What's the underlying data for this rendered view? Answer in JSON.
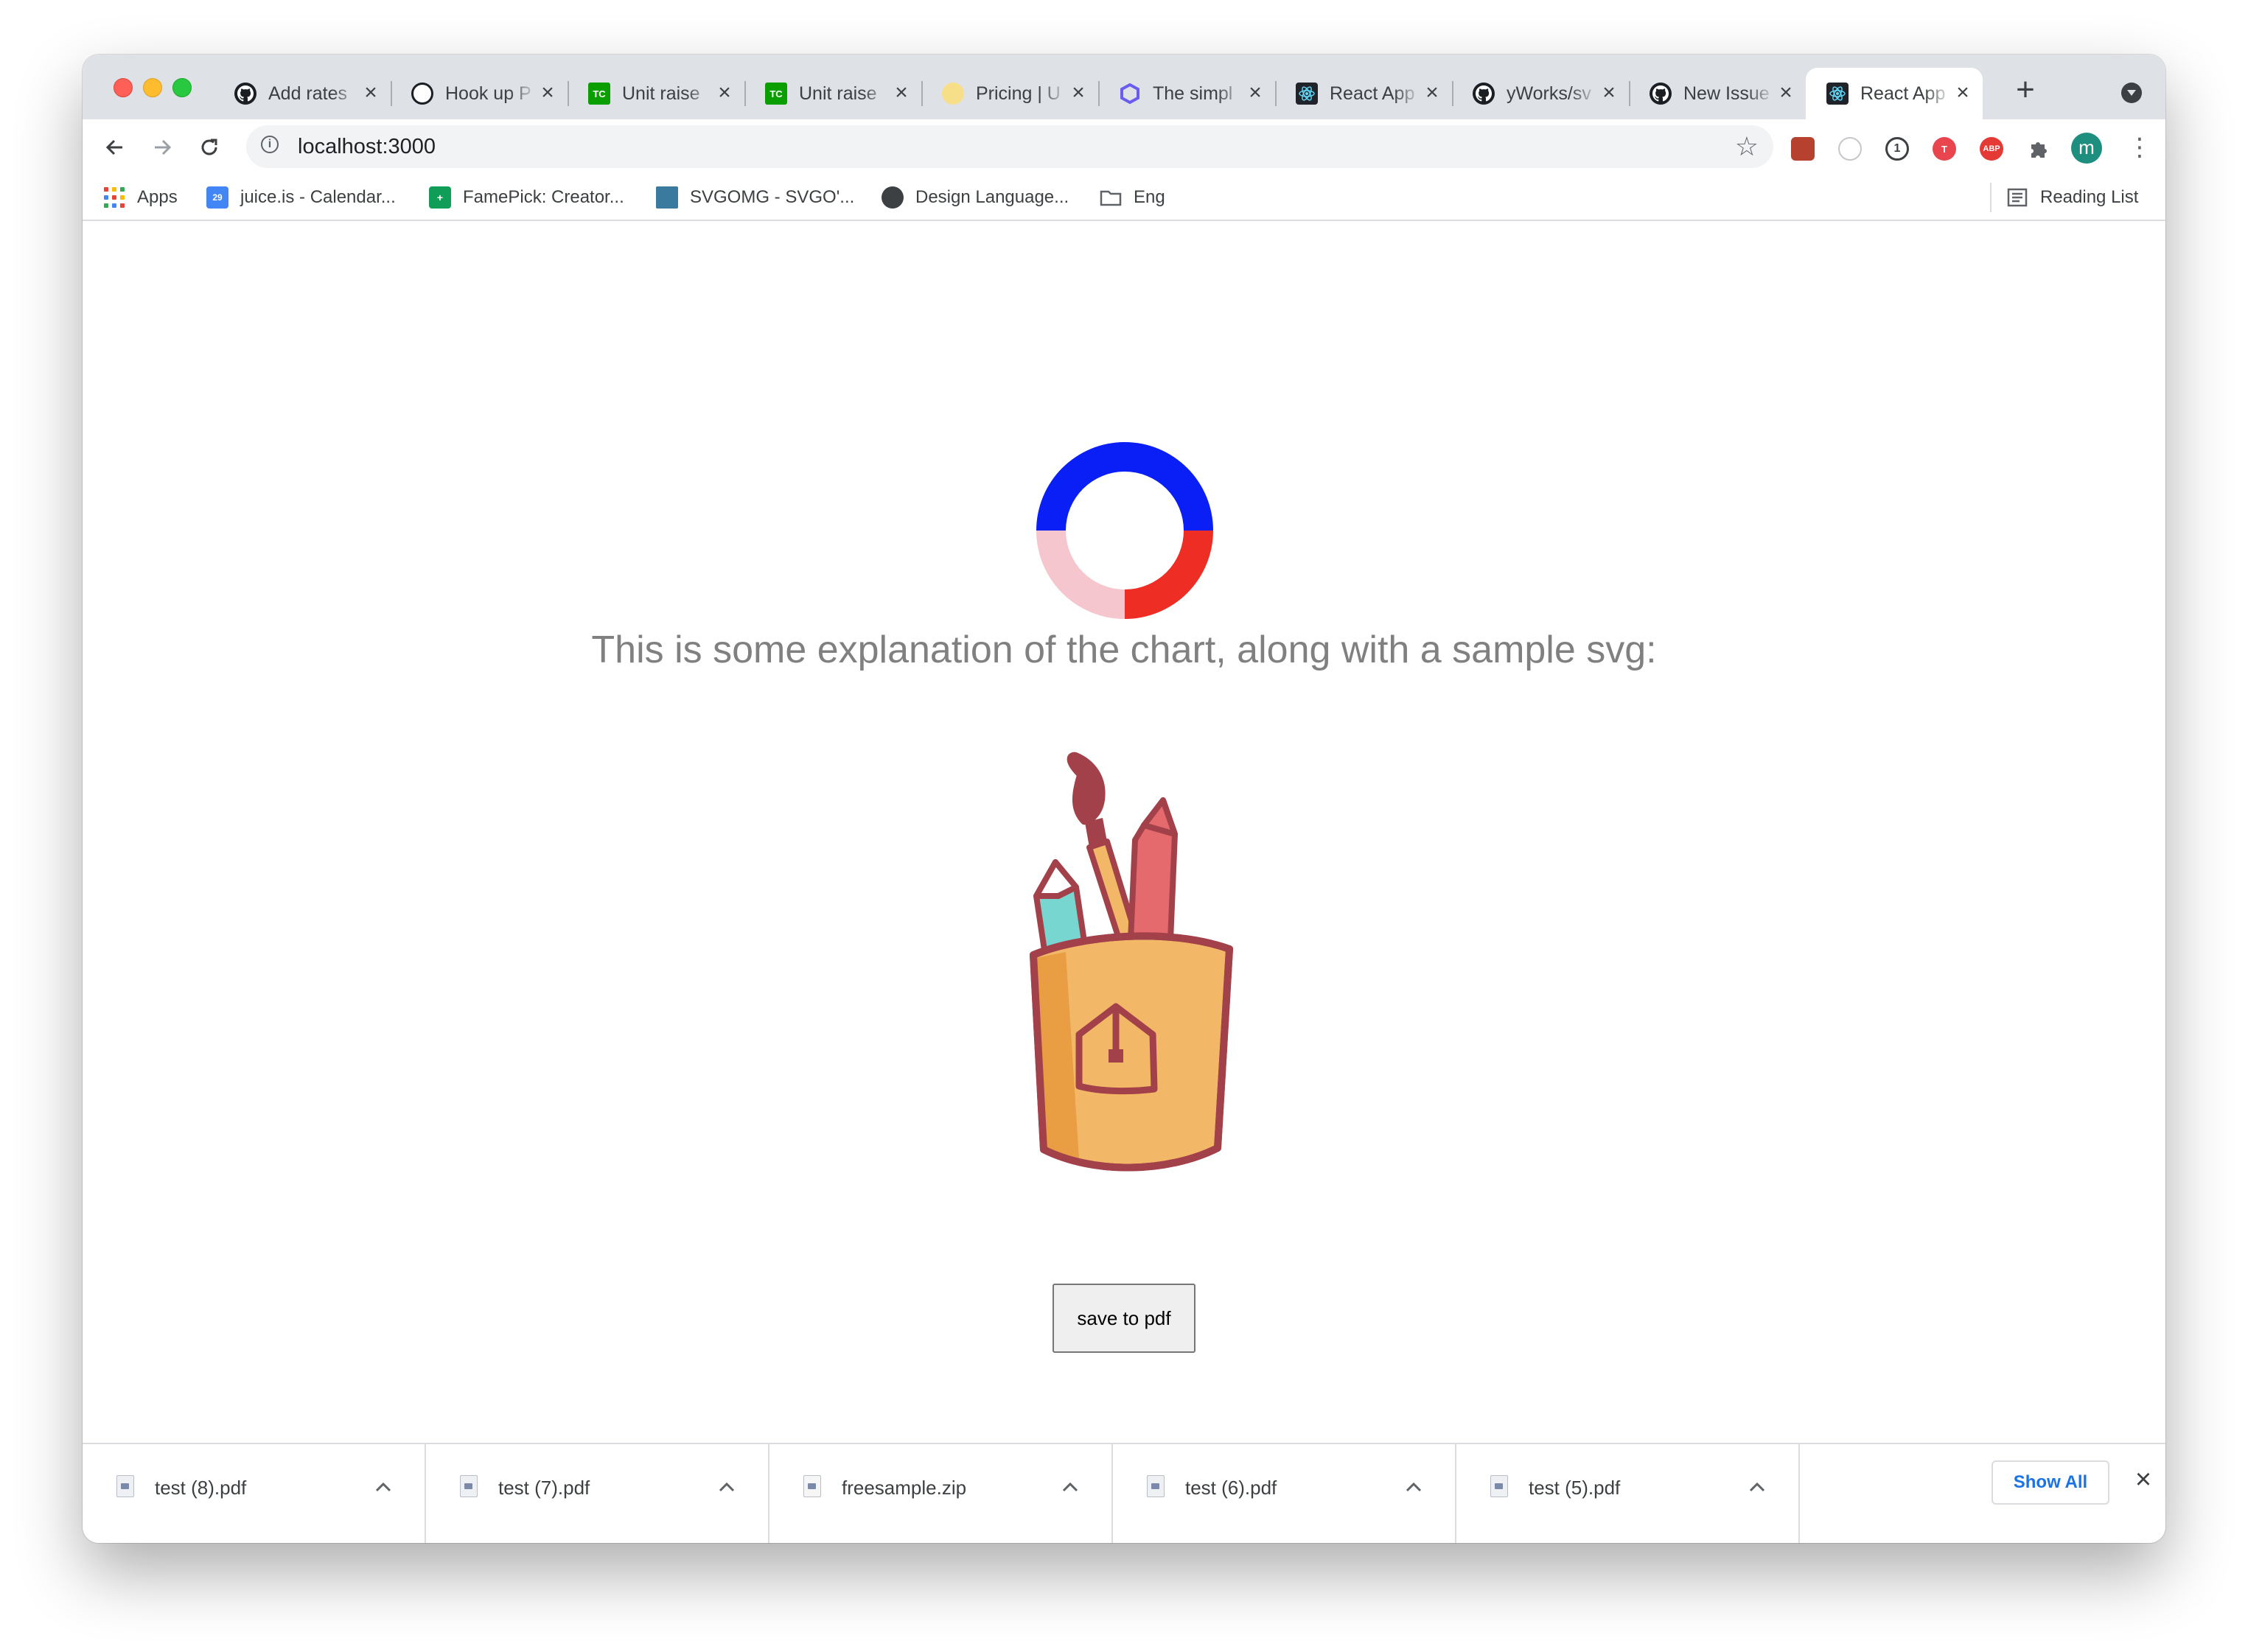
{
  "tabs": [
    {
      "title": "Add rates",
      "icon": "github-icon"
    },
    {
      "title": "Hook up P",
      "icon": "github-pr-icon"
    },
    {
      "title": "Unit raise",
      "icon": "techcrunch-icon"
    },
    {
      "title": "Unit raise",
      "icon": "techcrunch-icon"
    },
    {
      "title": "Pricing | U",
      "icon": "pricing-icon"
    },
    {
      "title": "The simpl",
      "icon": "hexagon-icon"
    },
    {
      "title": "React App",
      "icon": "react-icon"
    },
    {
      "title": "yWorks/sv",
      "icon": "github-icon"
    },
    {
      "title": "New Issue",
      "icon": "github-icon"
    },
    {
      "title": "React App",
      "icon": "react-icon",
      "active": true
    }
  ],
  "toolbar": {
    "url": "localhost:3000"
  },
  "bookmarks": [
    {
      "label": "Apps",
      "icon": "apps-grid-icon"
    },
    {
      "label": "juice.is - Calendar...",
      "icon": "calendar-icon"
    },
    {
      "label": "FamePick: Creator...",
      "icon": "sheets-icon"
    },
    {
      "label": "SVGOMG - SVGO'...",
      "icon": "svgomg-icon"
    },
    {
      "label": "Design Language...",
      "icon": "globe-icon"
    },
    {
      "label": "Eng",
      "icon": "folder-icon"
    }
  ],
  "reading_list": "Reading List",
  "content": {
    "caption": "This is some explanation of the chart, along with a sample svg:",
    "save_button": "save to pdf"
  },
  "chart_data": {
    "type": "pie",
    "style": "donut",
    "title": "",
    "slices": [
      {
        "value": 50,
        "color": "#0a1ff5"
      },
      {
        "value": 25,
        "color": "#ee2e24"
      },
      {
        "value": 25,
        "color": "#f5c6cd"
      }
    ]
  },
  "downloads": [
    {
      "name": "test (8).pdf",
      "icon": "pdf-file-icon"
    },
    {
      "name": "test (7).pdf",
      "icon": "pdf-file-icon"
    },
    {
      "name": "freesample.zip",
      "icon": "zip-file-icon"
    },
    {
      "name": "test (6).pdf",
      "icon": "pdf-file-icon"
    },
    {
      "name": "test (5).pdf",
      "icon": "pdf-file-icon"
    }
  ],
  "shelf": {
    "show_all": "Show All"
  },
  "colors": {
    "tabstrip_bg": "#dee1e6",
    "accent_blue": "#1a73e8",
    "caption_gray": "#808080"
  }
}
